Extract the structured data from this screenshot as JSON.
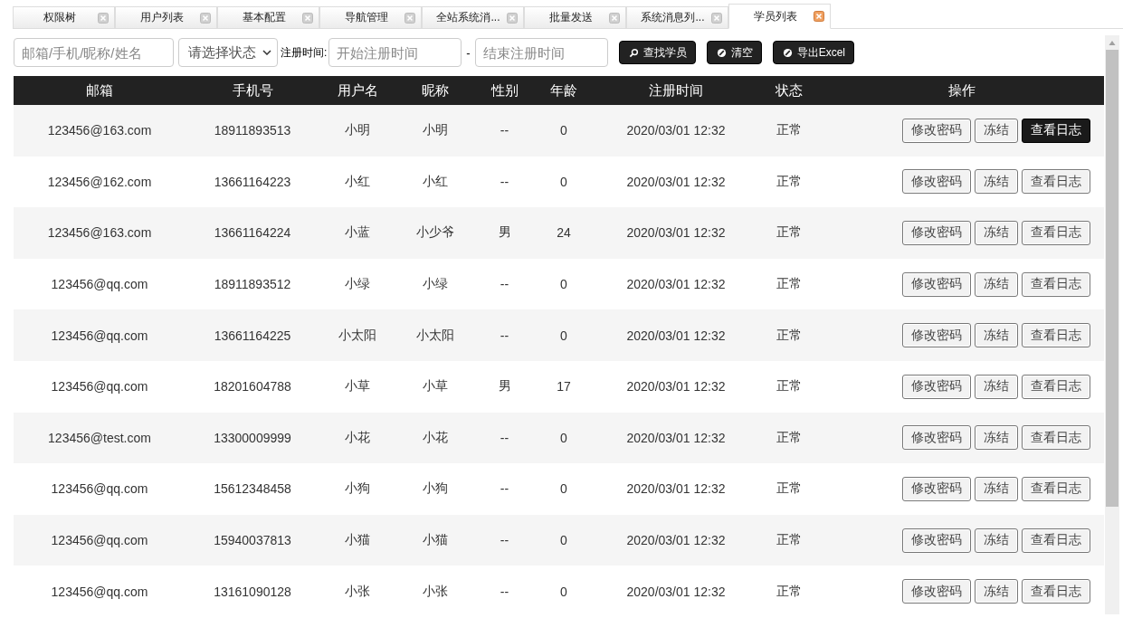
{
  "tabs": [
    {
      "label": "权限树",
      "selected": false
    },
    {
      "label": "用户列表",
      "selected": false
    },
    {
      "label": "基本配置",
      "selected": false
    },
    {
      "label": "导航管理",
      "selected": false
    },
    {
      "label": "全站系统消...",
      "selected": false
    },
    {
      "label": "批量发送",
      "selected": false
    },
    {
      "label": "系统消息列...",
      "selected": false
    },
    {
      "label": "学员列表",
      "selected": true
    }
  ],
  "filters": {
    "search": {
      "placeholder": "邮箱/手机/昵称/姓名"
    },
    "status": {
      "value": "请选择状态"
    },
    "date_label": "注册时间:",
    "start": {
      "placeholder": "开始注册时间"
    },
    "separator": "-",
    "end": {
      "placeholder": "结束注册时间"
    },
    "buttons": [
      {
        "label": "查找学员",
        "kind": "search"
      },
      {
        "label": "清空",
        "kind": "clear"
      },
      {
        "label": "导出Excel",
        "kind": "clear"
      }
    ]
  },
  "table": {
    "columns": [
      "邮箱",
      "手机号",
      "用户名",
      "昵称",
      "性别",
      "年龄",
      "注册时间",
      "状态",
      "操作"
    ],
    "rows": [
      {
        "cells": [
          "123456@163.com",
          "18911893513",
          "小明",
          "小明",
          "--",
          "0",
          "2020/03/01 12:32",
          "正常"
        ],
        "actions": [
          {
            "label": "修改密码",
            "active": false
          },
          {
            "label": "冻结",
            "active": false
          },
          {
            "label": "查看日志",
            "active": true
          }
        ]
      },
      {
        "cells": [
          "123456@162.com",
          "13661164223",
          "小红",
          "小红",
          "--",
          "0",
          "2020/03/01 12:32",
          "正常"
        ],
        "actions": [
          {
            "label": "修改密码",
            "active": false
          },
          {
            "label": "冻结",
            "active": false
          },
          {
            "label": "查看日志",
            "active": false
          }
        ]
      },
      {
        "cells": [
          "123456@163.com",
          "13661164224",
          "小蓝",
          "小少爷",
          "男",
          "24",
          "2020/03/01 12:32",
          "正常"
        ],
        "actions": [
          {
            "label": "修改密码",
            "active": false
          },
          {
            "label": "冻结",
            "active": false
          },
          {
            "label": "查看日志",
            "active": false
          }
        ]
      },
      {
        "cells": [
          "123456@qq.com",
          "18911893512",
          "小绿",
          "小绿",
          "--",
          "0",
          "2020/03/01 12:32",
          "正常"
        ],
        "actions": [
          {
            "label": "修改密码",
            "active": false
          },
          {
            "label": "冻结",
            "active": false
          },
          {
            "label": "查看日志",
            "active": false
          }
        ]
      },
      {
        "cells": [
          "123456@qq.com",
          "13661164225",
          "小太阳",
          "小太阳",
          "--",
          "0",
          "2020/03/01 12:32",
          "正常"
        ],
        "actions": [
          {
            "label": "修改密码",
            "active": false
          },
          {
            "label": "冻结",
            "active": false
          },
          {
            "label": "查看日志",
            "active": false
          }
        ]
      },
      {
        "cells": [
          "123456@qq.com",
          "18201604788",
          "小草",
          "小草",
          "男",
          "17",
          "2020/03/01 12:32",
          "正常"
        ],
        "actions": [
          {
            "label": "修改密码",
            "active": false
          },
          {
            "label": "冻结",
            "active": false
          },
          {
            "label": "查看日志",
            "active": false
          }
        ]
      },
      {
        "cells": [
          "123456@test.com",
          "13300009999",
          "小花",
          "小花",
          "--",
          "0",
          "2020/03/01 12:32",
          "正常"
        ],
        "actions": [
          {
            "label": "修改密码",
            "active": false
          },
          {
            "label": "冻结",
            "active": false
          },
          {
            "label": "查看日志",
            "active": false
          }
        ]
      },
      {
        "cells": [
          "123456@qq.com",
          "15612348458",
          "小狗",
          "小狗",
          "--",
          "0",
          "2020/03/01 12:32",
          "正常"
        ],
        "actions": [
          {
            "label": "修改密码",
            "active": false
          },
          {
            "label": "冻结",
            "active": false
          },
          {
            "label": "查看日志",
            "active": false
          }
        ]
      },
      {
        "cells": [
          "123456@qq.com",
          "15940037813",
          "小猫",
          "小猫",
          "--",
          "0",
          "2020/03/01 12:32",
          "正常"
        ],
        "actions": [
          {
            "label": "修改密码",
            "active": false
          },
          {
            "label": "冻结",
            "active": false
          },
          {
            "label": "查看日志",
            "active": false
          }
        ]
      },
      {
        "cells": [
          "123456@qq.com",
          "13161090128",
          "小张",
          "小张",
          "--",
          "0",
          "2020/03/01 12:32",
          "正常"
        ],
        "actions": [
          {
            "label": "修改密码",
            "active": false
          },
          {
            "label": "冻结",
            "active": false
          },
          {
            "label": "查看日志",
            "active": false
          }
        ]
      }
    ]
  }
}
